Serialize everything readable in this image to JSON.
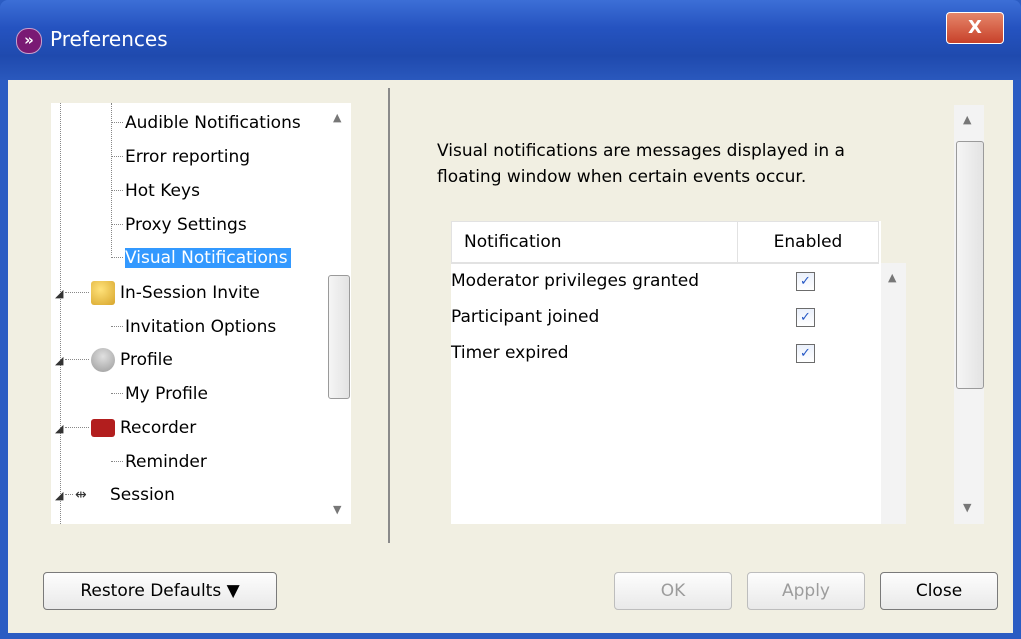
{
  "window": {
    "title": "Preferences",
    "close_glyph": "X",
    "app_icon": "chevron-right-icon"
  },
  "tree": {
    "items": [
      {
        "label": "Audible Notifications"
      },
      {
        "label": "Error reporting"
      },
      {
        "label": "Hot Keys"
      },
      {
        "label": "Proxy Settings"
      },
      {
        "label": "Visual Notifications",
        "selected": true
      },
      {
        "label": "In-Session Invite",
        "icon": "invite-icon"
      },
      {
        "label": "Invitation Options"
      },
      {
        "label": "Profile",
        "icon": "person-icon"
      },
      {
        "label": "My Profile"
      },
      {
        "label": "Recorder",
        "icon": "recorder-icon"
      },
      {
        "label": "Reminder"
      },
      {
        "label": "Session",
        "icon": "session-icon"
      }
    ]
  },
  "panel": {
    "description": "Visual notifications are messages displayed in a floating window when certain events occur.",
    "columns": [
      "Notification",
      "Enabled"
    ],
    "rows": [
      {
        "name": "Moderator privileges granted",
        "enabled": true
      },
      {
        "name": "Participant joined",
        "enabled": true
      },
      {
        "name": "Timer expired",
        "enabled": true
      }
    ]
  },
  "buttons": {
    "restore_defaults": "Restore Defaults ▼",
    "ok": "OK",
    "apply": "Apply",
    "close": "Close"
  },
  "colors": {
    "title_bar": "#2553c0",
    "selection": "#3399ff",
    "client_bg": "#f1efe2"
  }
}
